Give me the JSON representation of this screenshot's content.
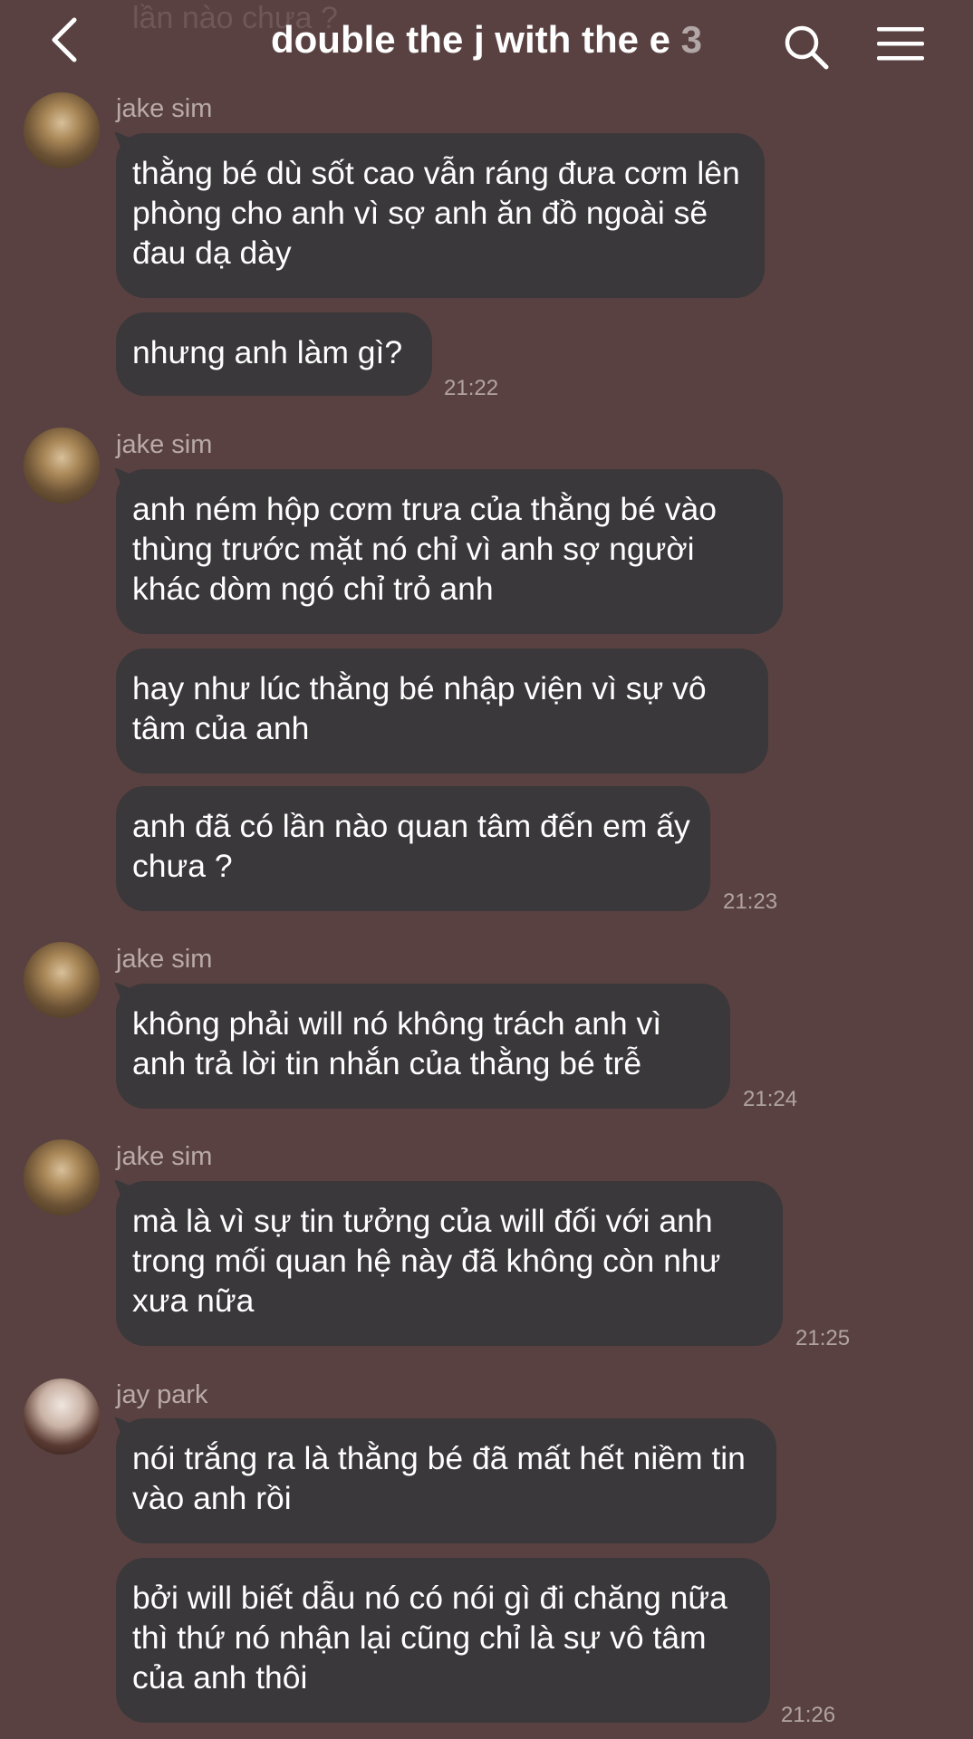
{
  "ghost_text": "lần nào chưa ?",
  "header": {
    "title": "double the j with the e",
    "member_count": "3"
  },
  "messages": [
    {
      "sender": "jake sim",
      "bubbles": [
        "thằng bé dù sốt cao vẫn ráng đưa cơm lên phòng cho anh vì sợ anh ăn đồ ngoài sẽ đau dạ dày",
        "nhưng anh làm gì?"
      ],
      "time": "21:22"
    },
    {
      "sender": "jake sim",
      "bubbles": [
        "anh ném hộp cơm trưa của thằng bé vào thùng trước mặt nó chỉ vì anh sợ người khác dòm ngó chỉ trỏ anh",
        "hay như lúc thằng bé nhập viện vì sự vô tâm của anh",
        "anh đã có lần nào quan tâm đến em ấy chưa ?"
      ],
      "time": "21:23"
    },
    {
      "sender": "jake sim",
      "bubbles": [
        "không phải will nó không trách anh vì anh trả lời tin nhắn của thằng bé trễ"
      ],
      "time": "21:24"
    },
    {
      "sender": "jake sim",
      "bubbles": [
        "mà là vì sự tin tưởng của will đối với anh trong mối quan hệ này đã không còn như xưa nữa"
      ],
      "time": "21:25"
    },
    {
      "sender": "jay park",
      "bubbles": [
        "nói trắng ra là thằng bé đã mất hết niềm tin vào anh rồi",
        "bởi will biết dẫu nó có nói gì đi chăng nữa thì thứ nó nhận lại cũng chỉ là sự vô tâm của anh thôi"
      ],
      "time": "21:26"
    }
  ]
}
